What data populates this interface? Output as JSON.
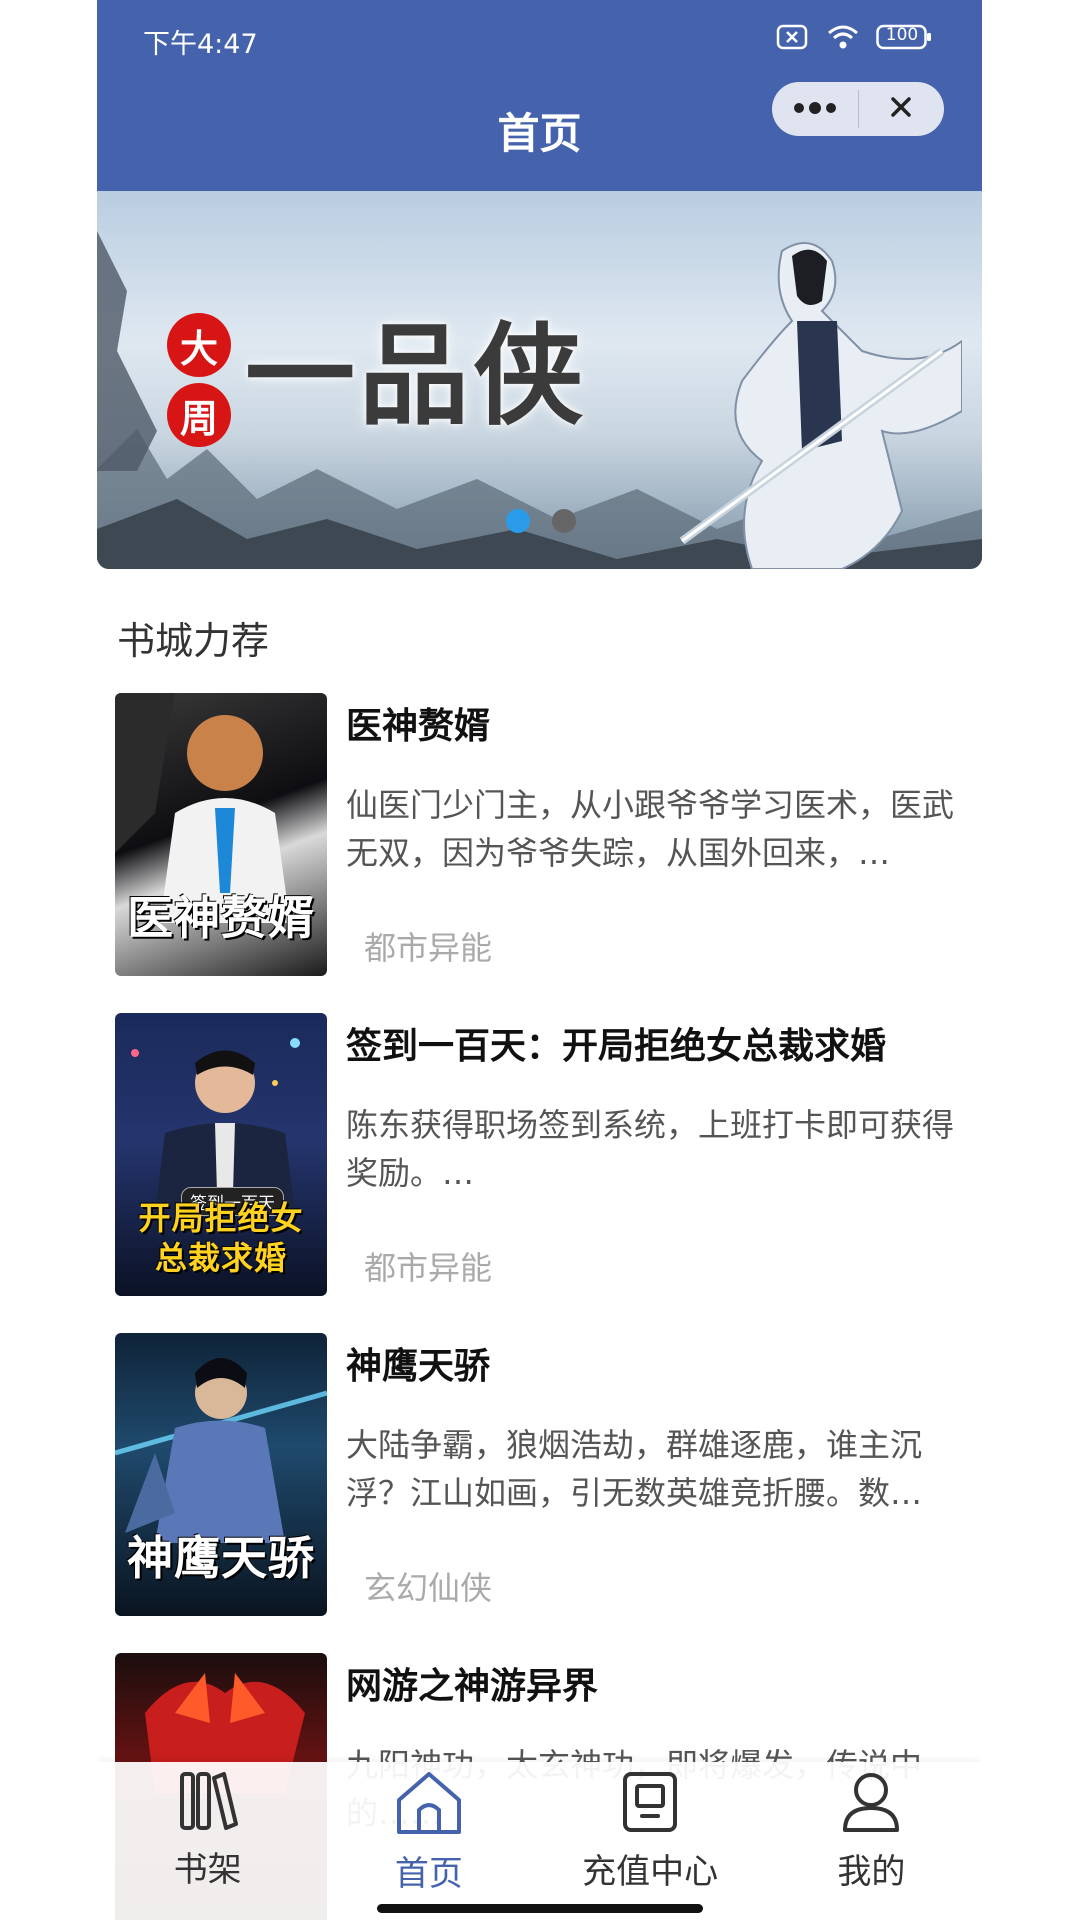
{
  "status_bar": {
    "time": "下午4:47",
    "battery": "100"
  },
  "header": {
    "title": "首页"
  },
  "banner": {
    "seal_chars": [
      "大",
      "周"
    ],
    "title": "一品侠",
    "active_dot": 0,
    "dot_count": 2,
    "colors": {
      "active_dot": "#2a9be8",
      "inactive_dot": "#666666"
    }
  },
  "section": {
    "title": "书城力荐"
  },
  "books": [
    {
      "title": "医神赘婿",
      "desc": "仙医门少门主，从小跟爷爷学习医术，医武无双，因为爷爷失踪，从国外回来，…",
      "tag": "都市异能",
      "cover_text": "医神赘婿"
    },
    {
      "title": "签到一百天：开局拒绝女总裁求婚",
      "desc": "陈东获得职场签到系统，上班打卡即可获得奖励。…",
      "tag": "都市异能",
      "cover_text": "开局拒绝女总裁求婚",
      "cover_subtitle": "签到一百天"
    },
    {
      "title": "神鹰天骄",
      "desc": "大陆争霸，狼烟浩劫，群雄逐鹿，谁主沉浮？江山如画，引无数英雄竞折腰。数…",
      "tag": "玄幻仙侠",
      "cover_text": "神鹰天骄"
    },
    {
      "title": "网游之神游异界",
      "desc": "九阳神功，太玄神功，即将爆发，传说中的……",
      "tag": "",
      "cover_text": ""
    }
  ],
  "tabbar": {
    "items": [
      {
        "label": "书架",
        "icon": "bookshelf-icon"
      },
      {
        "label": "首页",
        "icon": "home-icon",
        "active": true
      },
      {
        "label": "充值中心",
        "icon": "recharge-icon"
      },
      {
        "label": "我的",
        "icon": "user-icon"
      }
    ]
  },
  "colors": {
    "primary": "#4563ad",
    "text": "#111111",
    "muted": "#aaaaaa"
  }
}
